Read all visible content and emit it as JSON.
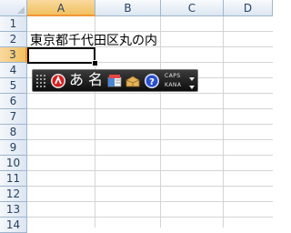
{
  "sheet": {
    "columns": [
      "A",
      "B",
      "C",
      "D"
    ],
    "rows": [
      "1",
      "2",
      "3",
      "4",
      "5",
      "6",
      "7",
      "8",
      "9",
      "10",
      "11",
      "12",
      "13",
      "14"
    ],
    "selected_column": "A",
    "selected_row": "3",
    "cells": {
      "A2": "東京都千代田区丸の内"
    }
  },
  "ime_toolbar": {
    "input_mode_char": "あ",
    "conversion_mode_char": "名",
    "caps_label": "CAPS",
    "kana_label": "KANA",
    "icons": [
      "ime-logo-icon",
      "dictionary-icon",
      "toolbox-icon",
      "help-icon"
    ]
  },
  "colors": {
    "selection_orange": "#f29536",
    "header_blue": "#dce6f1",
    "toolbar_black": "#0d0d0d"
  }
}
